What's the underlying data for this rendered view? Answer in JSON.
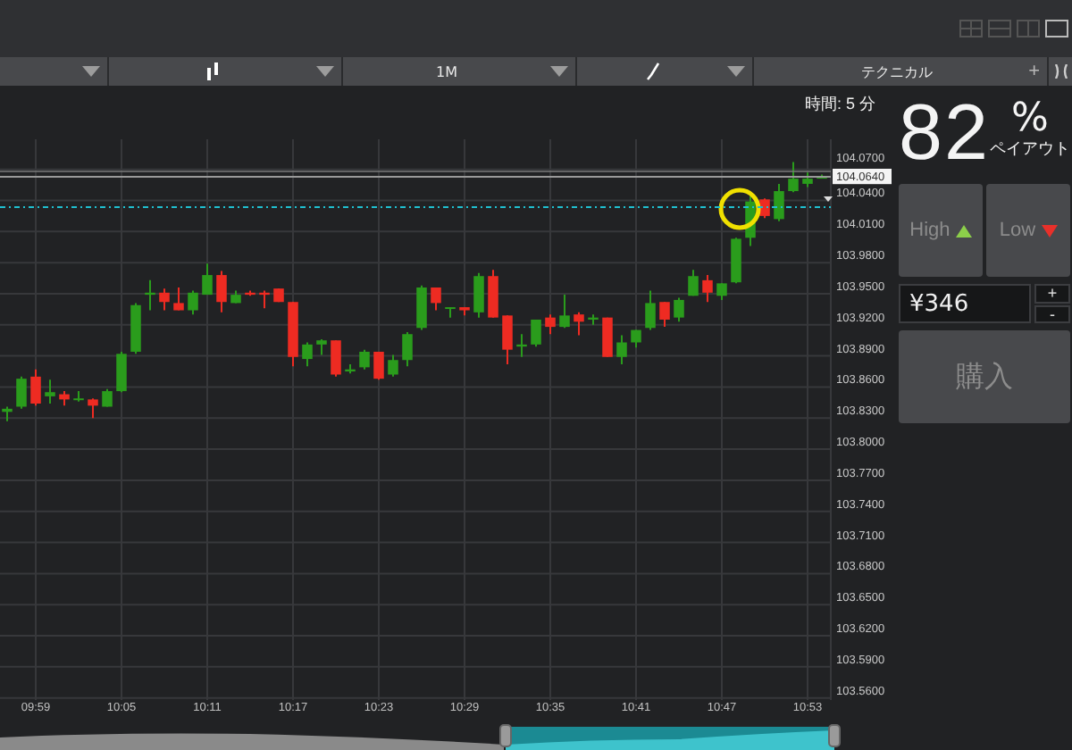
{
  "toolbar": [
    {
      "kind": "blank-dropdown"
    },
    {
      "kind": "chart-type"
    },
    {
      "kind": "text-dropdown",
      "label": "1M"
    },
    {
      "kind": "drawing-tool"
    },
    {
      "kind": "indicators",
      "label": "テクニカル",
      "add": "+"
    },
    {
      "kind": "collapse"
    }
  ],
  "chart": {
    "timeframe": "時間: 5 分",
    "current_price": "104.0640",
    "x_labels": [
      "09:59",
      "10:05",
      "10:11",
      "10:17",
      "10:23",
      "10:29",
      "10:35",
      "10:41",
      "10:47",
      "10:53"
    ],
    "chart_data": {
      "type": "candlestick",
      "ylim": [
        103.558,
        104.099
      ],
      "grid": true,
      "yticks": [
        {
          "value": 104.07,
          "label": "104.0700"
        },
        {
          "value": 104.04,
          "label": "104.0400"
        },
        {
          "value": 104.01,
          "label": "104.0100"
        },
        {
          "value": 103.98,
          "label": "103.9800"
        },
        {
          "value": 103.95,
          "label": "103.9500"
        },
        {
          "value": 103.92,
          "label": "103.9200"
        },
        {
          "value": 103.89,
          "label": "103.8900"
        },
        {
          "value": 103.86,
          "label": "103.8600"
        },
        {
          "value": 103.83,
          "label": "103.8300"
        },
        {
          "value": 103.8,
          "label": "103.8000"
        },
        {
          "value": 103.77,
          "label": "103.7700"
        },
        {
          "value": 103.74,
          "label": "103.7400"
        },
        {
          "value": 103.71,
          "label": "103.7100"
        },
        {
          "value": 103.68,
          "label": "103.6800"
        },
        {
          "value": 103.65,
          "label": "103.6500"
        },
        {
          "value": 103.62,
          "label": "103.6200"
        },
        {
          "value": 103.59,
          "label": "103.5900"
        },
        {
          "value": 103.56,
          "label": "103.5600"
        }
      ],
      "ohlc": [
        [
          103.836,
          103.841,
          103.827,
          103.839
        ],
        [
          103.841,
          103.87,
          103.839,
          103.868
        ],
        [
          103.87,
          103.877,
          103.842,
          103.844
        ],
        [
          103.851,
          103.867,
          103.844,
          103.855
        ],
        [
          103.853,
          103.856,
          103.842,
          103.848
        ],
        [
          103.848,
          103.856,
          103.846,
          103.849
        ],
        [
          103.848,
          103.849,
          103.83,
          103.842
        ],
        [
          103.841,
          103.858,
          103.841,
          103.856
        ],
        [
          103.856,
          103.894,
          103.855,
          103.892
        ],
        [
          103.894,
          103.941,
          103.892,
          103.939
        ],
        [
          103.949,
          103.963,
          103.934,
          103.951
        ],
        [
          103.951,
          103.955,
          103.934,
          103.942
        ],
        [
          103.941,
          103.956,
          103.934,
          103.934
        ],
        [
          103.934,
          103.953,
          103.93,
          103.951
        ],
        [
          103.949,
          103.979,
          103.949,
          103.968
        ],
        [
          103.968,
          103.972,
          103.932,
          103.942
        ],
        [
          103.941,
          103.953,
          103.941,
          103.949
        ],
        [
          103.951,
          103.953,
          103.948,
          103.949
        ],
        [
          103.951,
          103.953,
          103.936,
          103.949
        ],
        [
          103.955,
          103.955,
          103.942,
          103.942
        ],
        [
          103.942,
          103.942,
          103.88,
          103.889
        ],
        [
          103.887,
          103.903,
          103.88,
          103.901
        ],
        [
          103.901,
          103.906,
          103.891,
          103.905
        ],
        [
          103.905,
          103.905,
          103.87,
          103.872
        ],
        [
          103.875,
          103.882,
          103.873,
          103.877
        ],
        [
          103.879,
          103.896,
          103.877,
          103.894
        ],
        [
          103.894,
          103.894,
          103.867,
          103.868
        ],
        [
          103.872,
          103.891,
          103.87,
          103.886
        ],
        [
          103.886,
          103.913,
          103.88,
          103.911
        ],
        [
          103.917,
          103.958,
          103.915,
          103.956
        ],
        [
          103.956,
          103.956,
          103.934,
          103.941
        ],
        [
          103.936,
          103.937,
          103.927,
          103.937
        ],
        [
          103.937,
          103.937,
          103.929,
          103.934
        ],
        [
          103.932,
          103.97,
          103.927,
          103.967
        ],
        [
          103.967,
          103.973,
          103.927,
          103.927
        ],
        [
          103.929,
          103.929,
          103.882,
          103.896
        ],
        [
          103.899,
          103.911,
          103.889,
          103.901
        ],
        [
          103.901,
          103.925,
          103.899,
          103.925
        ],
        [
          103.927,
          103.93,
          103.911,
          103.918
        ],
        [
          103.918,
          103.949,
          103.917,
          103.929
        ],
        [
          103.93,
          103.932,
          103.91,
          103.923
        ],
        [
          103.925,
          103.93,
          103.92,
          103.927
        ],
        [
          103.927,
          103.927,
          103.889,
          103.889
        ],
        [
          103.889,
          103.91,
          103.882,
          103.903
        ],
        [
          103.903,
          103.915,
          103.898,
          103.915
        ],
        [
          103.917,
          103.953,
          103.915,
          103.941
        ],
        [
          103.942,
          103.942,
          103.918,
          103.925
        ],
        [
          103.927,
          103.946,
          103.923,
          103.944
        ],
        [
          103.948,
          103.973,
          103.948,
          103.967
        ],
        [
          103.963,
          103.968,
          103.942,
          103.951
        ],
        [
          103.948,
          103.96,
          103.944,
          103.96
        ],
        [
          103.961,
          104.004,
          103.96,
          104.003
        ],
        [
          104.004,
          104.044,
          103.996,
          104.039
        ],
        [
          104.041,
          104.042,
          104.023,
          104.025
        ],
        [
          104.022,
          104.056,
          104.02,
          104.049
        ],
        [
          104.049,
          104.077,
          104.048,
          104.061
        ],
        [
          104.056,
          104.067,
          104.053,
          104.061
        ],
        [
          104.061,
          104.065,
          104.061,
          104.063
        ]
      ]
    }
  },
  "payout": {
    "value": "82",
    "unit": "%",
    "label": "ペイアウト"
  },
  "trade_buttons": [
    {
      "kind": "high",
      "label": "High"
    },
    {
      "kind": "low",
      "label": "Low"
    }
  ],
  "amount": {
    "value": "¥346",
    "plus": "+",
    "minus": "-"
  },
  "buy_button": "購入"
}
